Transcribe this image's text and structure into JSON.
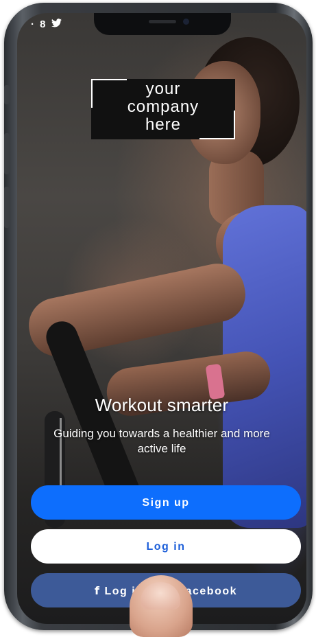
{
  "status_bar": {
    "left_icons": "· 8",
    "twitter_icon": "twitter-icon"
  },
  "logo": {
    "line1": "your",
    "line2": "company",
    "line3": "here"
  },
  "hero": {
    "title": "Workout smarter",
    "subtitle": "Guiding you towards a healthier and more active life"
  },
  "buttons": {
    "signup": "Sign up",
    "login": "Log in",
    "facebook": "Log in with Facebook",
    "facebook_visible_left": "Log i",
    "facebook_visible_right": "cebook"
  },
  "colors": {
    "signup_bg": "#0d6efd",
    "login_bg": "#ffffff",
    "login_text": "#1d5fd9",
    "facebook_bg": "#3d5a98",
    "accent_tank": "#4453b5",
    "band": "#d9728f"
  }
}
